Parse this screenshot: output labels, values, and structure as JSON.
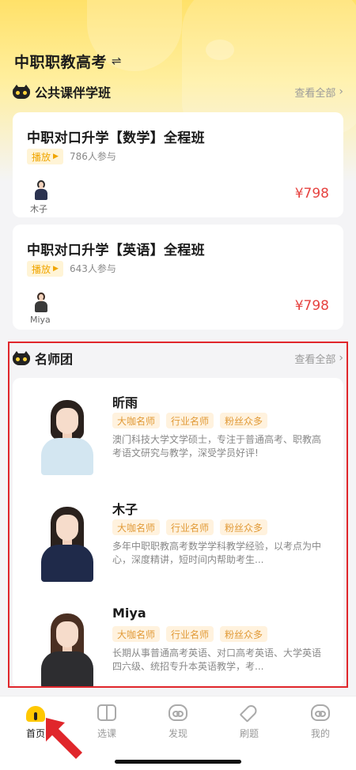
{
  "header": {
    "title": "中职职教高考",
    "swap_icon": "⇌"
  },
  "public_section": {
    "title": "公共课伴学班",
    "more": "查看全部"
  },
  "courses": [
    {
      "title": "中职对口升学【数学】全程班",
      "tag": "播放",
      "participants": "786人参与",
      "teacher": "木子",
      "price": "¥798"
    },
    {
      "title": "中职对口升学【英语】全程班",
      "tag": "播放",
      "participants": "643人参与",
      "teacher": "Miya",
      "price": "¥798"
    }
  ],
  "teacher_section": {
    "title": "名师团",
    "more": "查看全部"
  },
  "teachers": [
    {
      "name": "昕雨",
      "tags": [
        "大咖名师",
        "行业名师",
        "粉丝众多"
      ],
      "desc": "澳门科技大学文学硕士，专注于普通高考、职教高考语文研究与教学，深受学员好评!"
    },
    {
      "name": "木子",
      "tags": [
        "大咖名师",
        "行业名师",
        "粉丝众多"
      ],
      "desc": "多年中职职教高考数学学科教学经验，以考点为中心，深度精讲，短时间内帮助考生..."
    },
    {
      "name": "Miya",
      "tags": [
        "大咖名师",
        "行业名师",
        "粉丝众多"
      ],
      "desc": "长期从事普通高考英语、对口高考英语、大学英语四六级、统招专升本英语教学，考..."
    }
  ],
  "tabbar": [
    {
      "label": "首页",
      "icon": "home-icon",
      "active": true
    },
    {
      "label": "选课",
      "icon": "book-icon"
    },
    {
      "label": "发现",
      "icon": "cat-face-icon"
    },
    {
      "label": "刷题",
      "icon": "pen-icon"
    },
    {
      "label": "我的",
      "icon": "cat-head-icon"
    }
  ],
  "colors": {
    "brand_yellow": "#ffc800",
    "price_red": "#e64340",
    "highlight_border": "#e0262b",
    "tag_text": "#e19a37"
  }
}
